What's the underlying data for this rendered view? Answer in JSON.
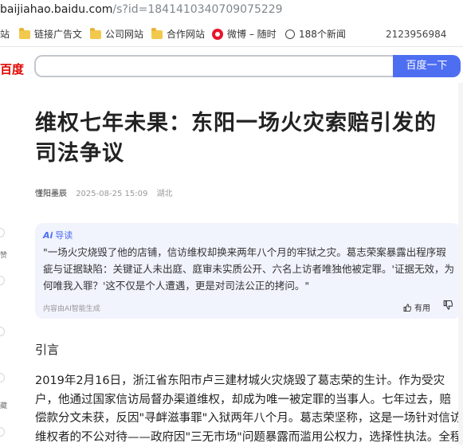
{
  "address_bar": {
    "host": "baijiahao.baidu.com",
    "path": "/s?id=1841410340709075229"
  },
  "bookmarks": {
    "items": [
      {
        "label": "站",
        "icon": "folder-icon"
      },
      {
        "label": "链接广告文",
        "icon": "folder-icon"
      },
      {
        "label": "公司网站",
        "icon": "folder-icon"
      },
      {
        "label": "合作网站",
        "icon": "folder-icon"
      },
      {
        "label": "微博 – 随时",
        "icon": "weibo-icon"
      },
      {
        "label": "188个新闻",
        "icon": "globe-icon"
      }
    ],
    "phone": "2123956984"
  },
  "search": {
    "logo": "百度",
    "button_label": "百度一下",
    "value": ""
  },
  "article": {
    "title": "维权七年未果：东阳一场火灾索赔引发的司法争议",
    "author": "懂阳墨辰",
    "date": "2025-08-25 15:09",
    "location": "湖北",
    "ai": {
      "heading_icon_text": "Ai",
      "heading": "导读",
      "summary": "\"一场火灾烧毁了他的店铺，信访维权却换来两年八个月的牢狱之灾。葛志荣案暴露出程序瑕疵与证据缺陷：关键证人未出庭、庭审未实质公开、六名上访者唯独他被定罪。'证据无效，为何唯我入罪？'这不仅是个人遭遇，更是对司法公正的拷问。\"",
      "footer": "内容由AI智能生成",
      "useful_label": "有用"
    },
    "intro_heading": "引言",
    "paragraph": "2019年2月16日，浙江省东阳市卢三建材城火灾烧毁了葛志荣的生计。作为受灾户，他通过国家信访局督办渠道维权，却成为唯一被定罪的当事人。七年过去，赔偿款分文未获，反因\"寻衅滋事罪\"入狱两年八个月。葛志荣坚称，这是一场针对信访维权者的不公对待——政府因\"三无市场\"问题暴露而滥用公权力，选择性执法。全程"
  },
  "side_rail": {
    "labels": [
      "赞",
      "藏"
    ]
  },
  "colors": {
    "accent": "#4e6ef2",
    "ai_bg": "#f1f3fd",
    "logo_red": "#e10602"
  }
}
